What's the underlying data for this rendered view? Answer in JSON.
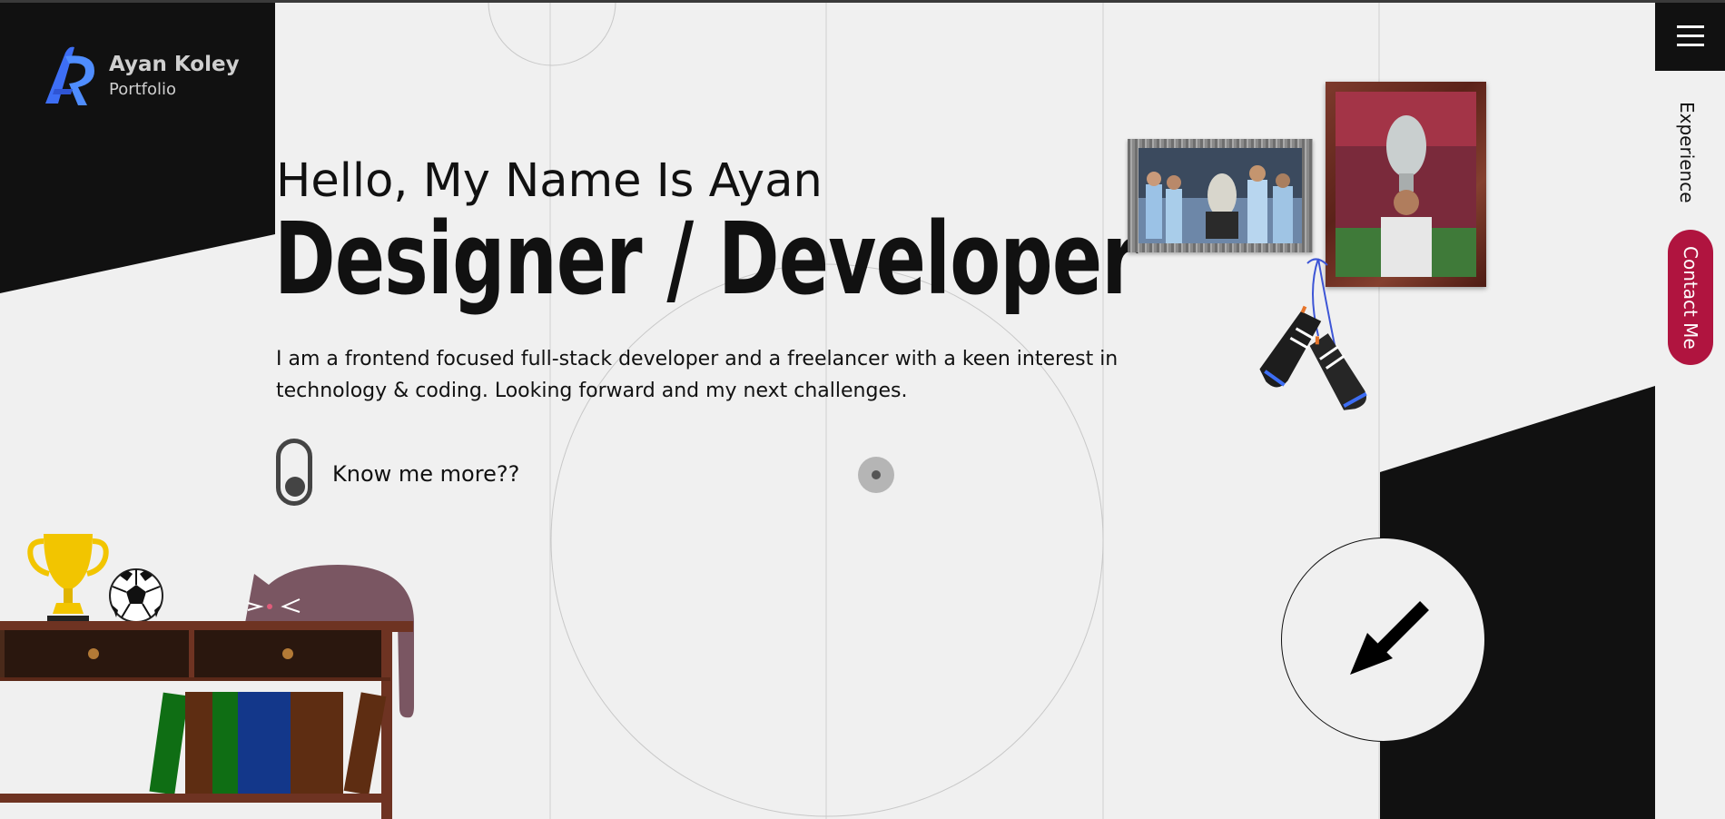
{
  "brand": {
    "name": "Ayan Koley",
    "subtitle": "Portfolio"
  },
  "hero": {
    "greeting": "Hello, My Name Is Ayan",
    "role": "Designer / Developer",
    "description": "I am a frontend focused full-stack developer and a freelancer with a keen interest in technology & coding. Looking forward and my next challenges.",
    "cta_label": "Know me more??"
  },
  "nav": {
    "menu_icon": "hamburger-icon",
    "experience_label": "Experience",
    "contact_label": "Contact Me"
  },
  "colors": {
    "dark": "#111111",
    "background": "#f0f0f0",
    "accent": "#b0143f",
    "logo_blue": "#3d6ef5"
  },
  "icons": {
    "scroll": "arrow-down-left-icon",
    "toggle": "toggle-switch-icon"
  }
}
